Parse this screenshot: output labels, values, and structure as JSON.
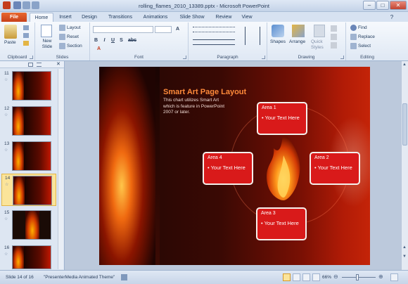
{
  "window": {
    "title": "rolling_flames_2010_13389.pptx - Microsoft PowerPoint"
  },
  "tabs": [
    {
      "label": "File"
    },
    {
      "label": "Home"
    },
    {
      "label": "Insert"
    },
    {
      "label": "Design"
    },
    {
      "label": "Transitions"
    },
    {
      "label": "Animations"
    },
    {
      "label": "Slide Show"
    },
    {
      "label": "Review"
    },
    {
      "label": "View"
    }
  ],
  "ribbon": {
    "clipboard": {
      "label": "Clipboard",
      "paste": "Paste"
    },
    "slides": {
      "label": "Slides",
      "new_slide": "New Slide",
      "layout": "Layout",
      "reset": "Reset",
      "section": "Section"
    },
    "font": {
      "label": "Font"
    },
    "paragraph": {
      "label": "Paragraph"
    },
    "drawing": {
      "label": "Drawing",
      "shapes": "Shapes",
      "arrange": "Arrange",
      "quick_styles": "Quick Styles"
    },
    "editing": {
      "label": "Editing",
      "find": "Find",
      "replace": "Replace",
      "select": "Select"
    }
  },
  "thumbnails": [
    {
      "num": "11"
    },
    {
      "num": "12"
    },
    {
      "num": "13"
    },
    {
      "num": "14"
    },
    {
      "num": "15"
    },
    {
      "num": "16"
    }
  ],
  "slide": {
    "title": "Smart Art Page Layout",
    "body": "This chart utilizes Smart Art which is feature in PowerPoint 2007 or later.",
    "areas": [
      {
        "name": "Area 1",
        "text": "Your Text Here"
      },
      {
        "name": "Area 2",
        "text": "Your Text Here"
      },
      {
        "name": "Area 3",
        "text": "Your Text Here"
      },
      {
        "name": "Area 4",
        "text": "Your Text Here"
      }
    ]
  },
  "status": {
    "slide_info": "Slide 14 of 16",
    "theme": "\"PresenterMedia Animated Theme\"",
    "zoom": "66%"
  },
  "colors": {
    "file_tab": "#d4511f",
    "area_box": "#d91a1a",
    "title_accent": "#ff8a3a"
  }
}
